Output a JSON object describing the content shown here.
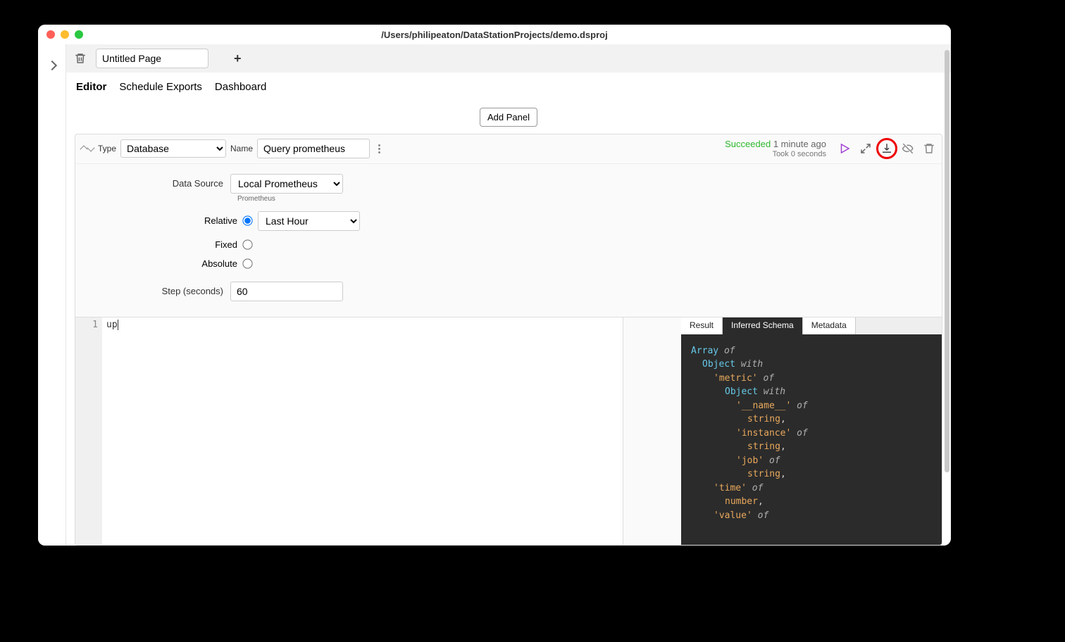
{
  "window": {
    "title": "/Users/philipeaton/DataStationProjects/demo.dsproj"
  },
  "page": {
    "name_value": "Untitled Page"
  },
  "nav": {
    "editor": "Editor",
    "schedule": "Schedule Exports",
    "dashboard": "Dashboard"
  },
  "buttons": {
    "add_panel": "Add Panel"
  },
  "panel_header": {
    "type_label": "Type",
    "type_value": "Database",
    "name_label": "Name",
    "name_value": "Query prometheus",
    "status_success": "Succeeded",
    "status_when": "1 minute ago",
    "status_took": "Took 0 seconds"
  },
  "form": {
    "data_source_label": "Data Source",
    "data_source_value": "Local Prometheus",
    "data_source_hint": "Prometheus",
    "relative_label": "Relative",
    "relative_value": "Last Hour",
    "fixed_label": "Fixed",
    "absolute_label": "Absolute",
    "step_label": "Step (seconds)",
    "step_value": "60"
  },
  "editor": {
    "line_number": "1",
    "code": "up"
  },
  "result_tabs": {
    "result": "Result",
    "inferred": "Inferred Schema",
    "metadata": "Metadata"
  },
  "schema": {
    "array": "Array",
    "of": "of",
    "object": "Object",
    "with": "with",
    "metric": "'metric'",
    "name": "'__name__'",
    "instance": "'instance'",
    "job": "'job'",
    "time": "'time'",
    "value": "'value'",
    "string": "string",
    "number": "number",
    "comma": ","
  }
}
